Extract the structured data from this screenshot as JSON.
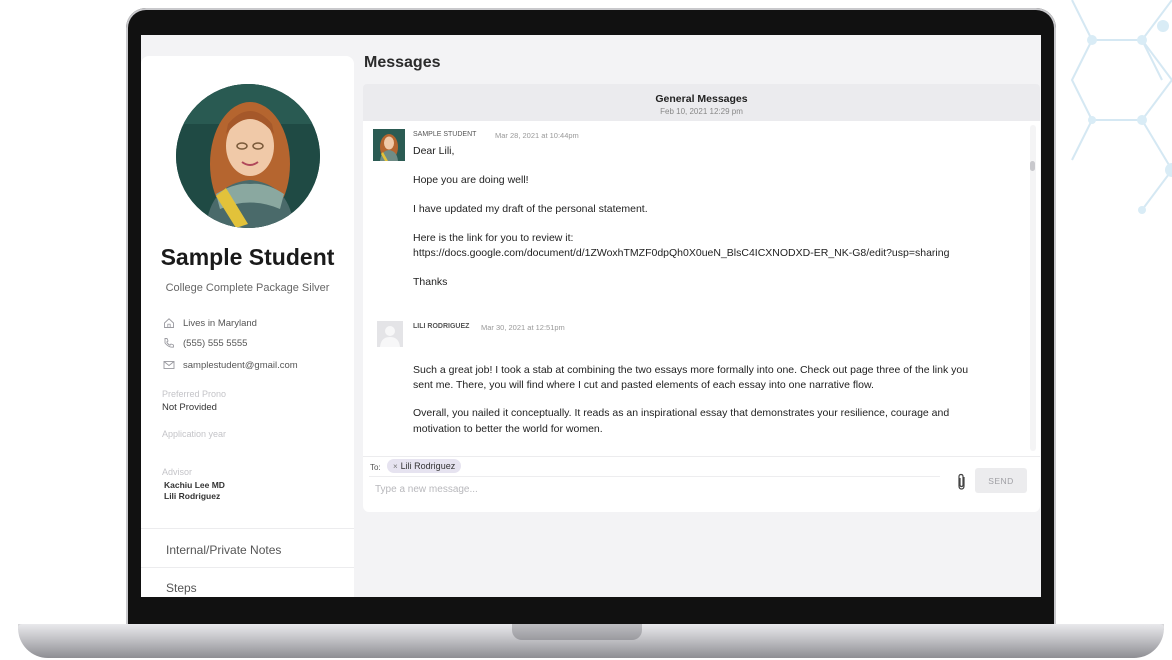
{
  "sidebar": {
    "name": "Sample Student",
    "package": "College Complete Package Silver",
    "location": "Lives in Maryland",
    "phone": "(555) 555 5555",
    "email": "samplestudent@gmail.com",
    "pronoun_label": "Preferred Prono",
    "pronoun_value": "Not Provided",
    "app_year_label": "Application year",
    "advisor_label": "Advisor",
    "advisors": [
      "Kachiu Lee MD",
      "Lili Rodriguez"
    ],
    "sections": [
      "Internal/Private Notes",
      "Steps"
    ]
  },
  "main": {
    "title": "Messages",
    "thread": {
      "title": "General Messages",
      "date": "Feb 10, 2021 12:29 pm"
    },
    "messages": [
      {
        "sender": "SAMPLE STUDENT",
        "time": "Mar 28, 2021 at 10:44pm",
        "lines": [
          "Dear Lili,",
          "Hope you are doing well!",
          "I have updated my draft of the personal statement.",
          "Here is the link for you to review it:",
          "https://docs.google.com/document/d/1ZWoxhTMZF0dpQh0X0ueN_BlsC4ICXNODXD-ER_NK-G8/edit?usp=sharing",
          "Thanks"
        ]
      },
      {
        "sender": "LILI RODRIGUEZ",
        "time": "Mar 30, 2021 at 12:51pm",
        "lines": [
          "Such a great job!  I took a stab at combining the two essays more formally into one.  Check out page three of the link you",
          "sent me.  There, you will find where I cut and pasted elements of each essay into one narrative flow.",
          "Overall, you nailed it conceptually.  It reads as an inspirational essay that demonstrates your resilience, courage and",
          "motivation to better the world for women."
        ]
      }
    ],
    "composer": {
      "to_label": "To:",
      "recipient": "Lili Rodriguez",
      "placeholder": "Type a new message...",
      "send_label": "SEND"
    }
  },
  "colors": {
    "screen_bg": "#f3f3f5",
    "chip_bg": "#e6e3f0",
    "avatar_bg": "#1f4a44",
    "hair": "#b5652f",
    "scarf": "#e2c23a"
  },
  "icons": [
    "home-icon",
    "phone-icon",
    "mail-icon",
    "paperclip-icon",
    "close-icon"
  ]
}
